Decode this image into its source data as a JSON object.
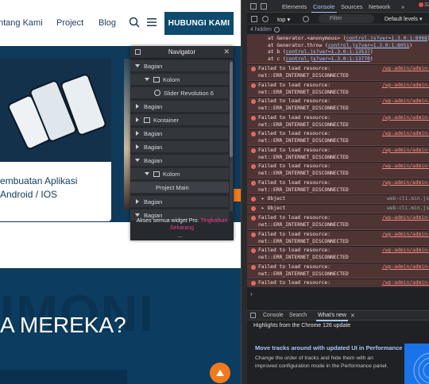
{
  "site": {
    "nav": {
      "links": [
        "ntang Kami",
        "Project",
        "Blog"
      ],
      "cta": "HUBUNGI KAMI"
    },
    "card": {
      "title_line1": "embuatan Aplikasi",
      "title_line2": "Android / IOS"
    },
    "testimonial": {
      "bg_text": "IMONI",
      "title": "A MEREKA?"
    }
  },
  "navigator": {
    "title": "Navigator",
    "rows": [
      {
        "label": "Bagian",
        "indent": 0,
        "icon": "caret"
      },
      {
        "label": "Kolom",
        "indent": 1,
        "icon": "column"
      },
      {
        "label": "Slider Revolution 6",
        "indent": 2,
        "icon": "ring"
      },
      {
        "label": "Bagian",
        "indent": 0,
        "icon": "caret-right"
      },
      {
        "label": "Kontainer",
        "indent": 0,
        "icon": "container"
      },
      {
        "label": "Bagian",
        "indent": 0,
        "icon": "caret-right"
      },
      {
        "label": "Bagian",
        "indent": 0,
        "icon": "caret-right"
      },
      {
        "label": "Bagian",
        "indent": 0,
        "icon": "caret"
      },
      {
        "label": "Kolom",
        "indent": 1,
        "icon": "column"
      },
      {
        "label": "Project Main",
        "indent": 2,
        "icon": "none"
      },
      {
        "label": "Bagian",
        "indent": 0,
        "icon": "caret-right"
      },
      {
        "label": "Bagian",
        "indent": 0,
        "icon": "caret"
      }
    ],
    "footer_text": "Akses semua widget Pro.",
    "footer_link": "Tingkatkan Sekarang",
    "footer_more": "..."
  },
  "devtools": {
    "tabs": [
      "Elements",
      "Console",
      "Sources",
      "Network"
    ],
    "active_tab": "Console",
    "error_count": "32",
    "context": "top",
    "filter_placeholder": "Filter",
    "levels": "Default levels",
    "hidden": "4 hidden",
    "pre_lines": [
      {
        "prefix": "at Generator.<anonymous> (",
        "link": "control.js?ver=1.3.0:1:8968",
        "suffix": ")"
      },
      {
        "prefix": "at Generator.throw (",
        "link": "control.js?ver=1.3.0:1:8051",
        "suffix": ")"
      },
      {
        "prefix": "at b (",
        "link": "control.js?ver=1.3.0:1:13537",
        "suffix": ")"
      },
      {
        "prefix": "at c (",
        "link": "control.js?ver=1.3.0:1:13770",
        "suffix": ")"
      }
    ],
    "messages": [
      {
        "kind": "error",
        "line1": "Failed to load resource:",
        "line2": "net::ERR_INTERNET_DISCONNECTED",
        "source": "/wp-admin/admin-a"
      },
      {
        "kind": "error",
        "line1": "Failed to load resource:",
        "line2": "net::ERR_INTERNET_DISCONNECTED",
        "source": "/wp-admin/admin-a"
      },
      {
        "kind": "error",
        "line1": "Failed to load resource:",
        "line2": "net::ERR_INTERNET_DISCONNECTED",
        "source": "/wp-admin/admin-a"
      },
      {
        "kind": "error",
        "line1": "Failed to load resource:",
        "line2": "net::ERR_INTERNET_DISCONNECTED",
        "source": "/wp-admin/admin-a"
      },
      {
        "kind": "error",
        "line1": "Failed to load resource:",
        "line2": "net::ERR_INTERNET_DISCONNECTED",
        "source": "/wp-admin/admin-a"
      },
      {
        "kind": "error",
        "line1": "Failed to load resource:",
        "line2": "net::ERR_INTERNET_DISCONNECTED",
        "source": "/wp-admin/admin-a"
      },
      {
        "kind": "error",
        "line1": "Failed to load resource:",
        "line2": "net::ERR_INTERNET_DISCONNECTED",
        "source": "/wp-admin/admin-a"
      },
      {
        "kind": "error",
        "line1": "Failed to load resource:",
        "line2": "net::ERR_INTERNET_DISCONNECTED",
        "source": "/wp-admin/admin-a"
      },
      {
        "kind": "object",
        "line1": "▸ Object",
        "line2": "",
        "source": "web-cli.min.js"
      },
      {
        "kind": "object",
        "line1": "▸ Object",
        "line2": "",
        "source": "web-cli.min.js"
      },
      {
        "kind": "error",
        "line1": "Failed to load resource:",
        "line2": "net::ERR_INTERNET_DISCONNECTED",
        "source": "/wp-admin/admin-a"
      },
      {
        "kind": "error",
        "line1": "Failed to load resource:",
        "line2": "net::ERR_INTERNET_DISCONNECTED",
        "source": "/wp-admin/admin-a"
      },
      {
        "kind": "error",
        "line1": "Failed to load resource:",
        "line2": "net::ERR_INTERNET_DISCONNECTED",
        "source": "/wp-admin/admin-a"
      },
      {
        "kind": "error",
        "line1": "Failed to load resource:",
        "line2": "net::ERR_INTERNET_DISCONNECTED",
        "source": "/wp-admin/admin-a"
      },
      {
        "kind": "error",
        "line1": "Failed to load resource:",
        "line2": "net::ERR_INTERNET_DISCONNECTED",
        "source": "/wp-admin/admin-a"
      }
    ],
    "drawer_tabs": [
      "Console",
      "Search",
      "What's new"
    ],
    "drawer_active": "What's new",
    "update_text": "Highlights from the Chrome 126 update",
    "whats_new_title": "Move tracks around with updated UI in Performance panel",
    "whats_new_body": "Change the order of tracks and hide them with an improved configuration mode in the Performance panel."
  }
}
